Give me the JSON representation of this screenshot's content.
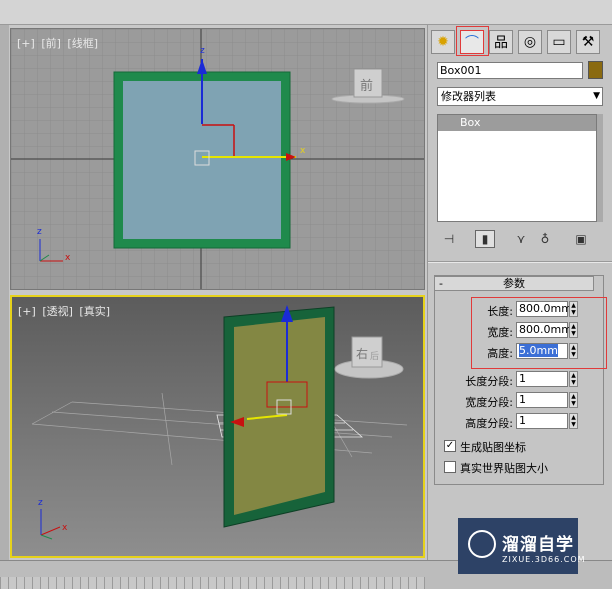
{
  "viewports": {
    "front": {
      "labels": [
        "[+]",
        "[前]",
        "[线框]"
      ],
      "viewcube": "前",
      "axis_z": "z",
      "axis_x": "x"
    },
    "perspective": {
      "labels": [
        "[+]",
        "[透视]",
        "[真实]"
      ],
      "viewcube": "右",
      "viewcube2": "后",
      "axis_z": "z",
      "axis_x": "x"
    }
  },
  "panel": {
    "tabs": [
      {
        "name": "create-tab",
        "icon": "sun-icon"
      },
      {
        "name": "modify-tab",
        "icon": "curve-icon"
      },
      {
        "name": "hierarchy-tab",
        "icon": "hierarchy-icon"
      },
      {
        "name": "motion-tab",
        "icon": "circle-icon"
      },
      {
        "name": "display-tab",
        "icon": "monitor-icon"
      },
      {
        "name": "utilities-tab",
        "icon": "hammer-icon"
      }
    ],
    "object_name": "Box001",
    "object_color": "#8a6a10",
    "modifier_list": "修改器列表",
    "stack_items": [
      "Box"
    ],
    "rollout_title": "参数",
    "params": [
      {
        "label": "长度:",
        "value": "800.0mm",
        "selected": false
      },
      {
        "label": "宽度:",
        "value": "800.0mm",
        "selected": false
      },
      {
        "label": "高度:",
        "value": "5.0mm",
        "selected": true
      }
    ],
    "segments": [
      {
        "label": "长度分段:",
        "value": "1"
      },
      {
        "label": "宽度分段:",
        "value": "1"
      },
      {
        "label": "高度分段:",
        "value": "1"
      }
    ],
    "checkboxes": [
      {
        "label": "生成贴图坐标",
        "checked": true
      },
      {
        "label": "真实世界贴图大小",
        "checked": false
      }
    ]
  },
  "watermark": {
    "title": "溜溜自学",
    "subtitle": "ZIXUE.3D66.COM"
  },
  "colors": {
    "accent_highlight": "#e03a3a",
    "active_viewport": "#e6d21a",
    "frame_green": "#1f8a4c"
  }
}
